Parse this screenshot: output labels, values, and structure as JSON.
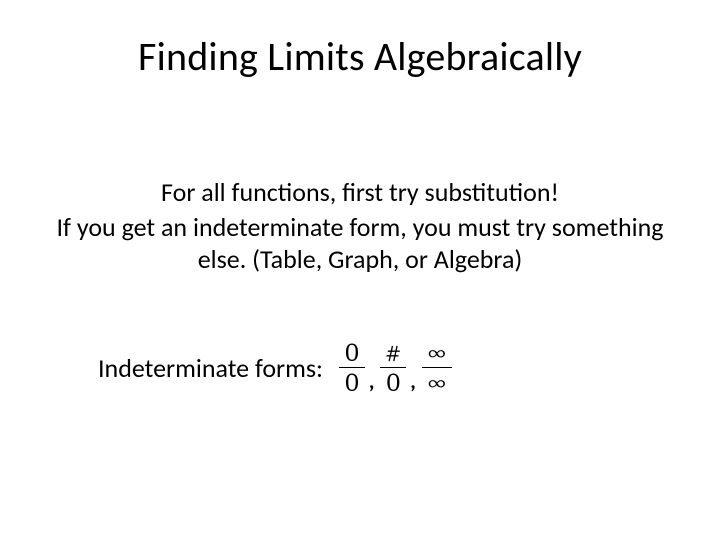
{
  "title": "Finding Limits Algebraically",
  "body": {
    "line1": "For all functions, first try substitution!",
    "line2": "If you get an indeterminate form, you must try something else. (Table, Graph, or Algebra)"
  },
  "forms": {
    "label": "Indeterminate forms:",
    "fractions": [
      {
        "num": "0",
        "den": "0"
      },
      {
        "num": "#",
        "den": "0"
      },
      {
        "num": "∞",
        "den": "∞"
      }
    ],
    "separator": ","
  }
}
